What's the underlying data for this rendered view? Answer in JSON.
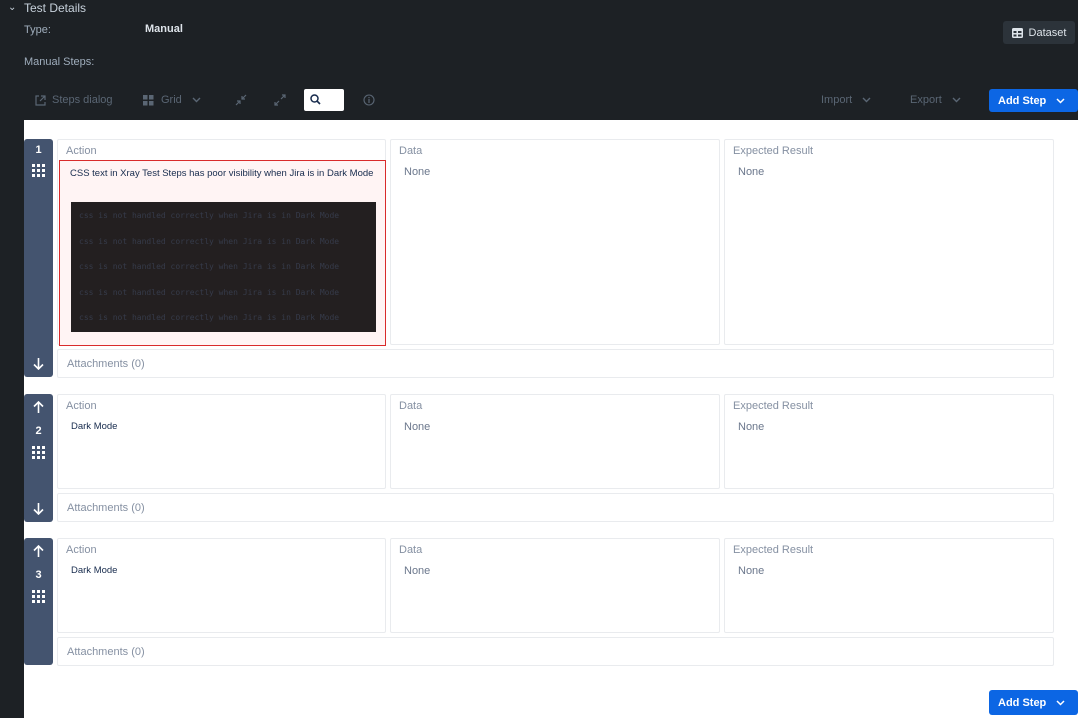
{
  "header": {
    "section_title": "Test Details",
    "type_label": "Type:",
    "type_value": "Manual",
    "manual_steps_label": "Manual Steps:",
    "dataset_label": "Dataset"
  },
  "toolbar": {
    "steps_dialog": "Steps dialog",
    "grid": "Grid",
    "import": "Import",
    "export": "Export",
    "add_step": "Add Step"
  },
  "columns": {
    "action": "Action",
    "data": "Data",
    "expected": "Expected Result"
  },
  "steps": [
    {
      "number": "1",
      "action": "CSS text in Xray Test Steps has poor visibility when Jira is in Dark Mode",
      "code_lines": [
        "css is not handled correctly when Jira is in Dark Mode",
        "css is not handled correctly when Jira is in Dark Mode",
        "css is not handled correctly when Jira is in Dark Mode",
        "css is not handled correctly when Jira is in Dark Mode",
        "css is not handled correctly when Jira is in Dark Mode"
      ],
      "data": "None",
      "expected": "None",
      "attachments": "Attachments (0)"
    },
    {
      "number": "2",
      "action": "Dark Mode",
      "data": "None",
      "expected": "None",
      "attachments": "Attachments (0)"
    },
    {
      "number": "3",
      "action": "Dark Mode",
      "data": "None",
      "expected": "None",
      "attachments": "Attachments (0)"
    }
  ],
  "footer": {
    "add_step": "Add Step"
  },
  "colors": {
    "primary": "#0c66e4",
    "highlight": "#d92b2b",
    "rail": "#44546f",
    "background": "#1d2125"
  }
}
